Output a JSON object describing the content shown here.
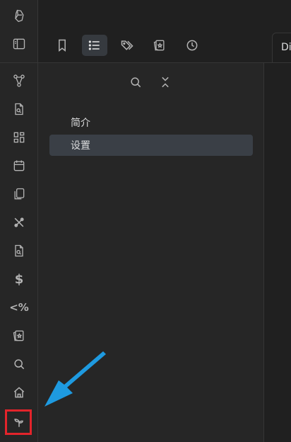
{
  "ribbon": {
    "icons": [
      {
        "name": "logo-icon"
      },
      {
        "name": "sidebar-toggle-icon"
      },
      {
        "name": "graph-view-icon"
      },
      {
        "name": "search-file-icon"
      },
      {
        "name": "grid-icon"
      },
      {
        "name": "calendar-icon"
      },
      {
        "name": "copy-icon"
      },
      {
        "name": "tools-icon"
      },
      {
        "name": "file-search-icon"
      },
      {
        "name": "dollar-icon",
        "glyph": "$"
      },
      {
        "name": "percent-icon",
        "glyph": "<%"
      },
      {
        "name": "card-icon"
      },
      {
        "name": "search-icon"
      },
      {
        "name": "home-icon"
      },
      {
        "name": "sprout-icon"
      }
    ],
    "highlight_color": "#e3242b"
  },
  "tabs": [
    {
      "name": "bookmark-icon",
      "active": false
    },
    {
      "name": "list-icon",
      "active": true
    },
    {
      "name": "tags-icon",
      "active": false
    },
    {
      "name": "cards-icon",
      "active": false
    },
    {
      "name": "clock-icon",
      "active": false
    }
  ],
  "panel": {
    "tools": [
      "search-icon",
      "collapse-icon"
    ],
    "outline": [
      {
        "label": "简介",
        "active": false
      },
      {
        "label": "设置",
        "active": true
      }
    ]
  },
  "right_tab": {
    "label": "Di"
  },
  "annotation": {
    "arrow_color": "#1e9ae0"
  }
}
